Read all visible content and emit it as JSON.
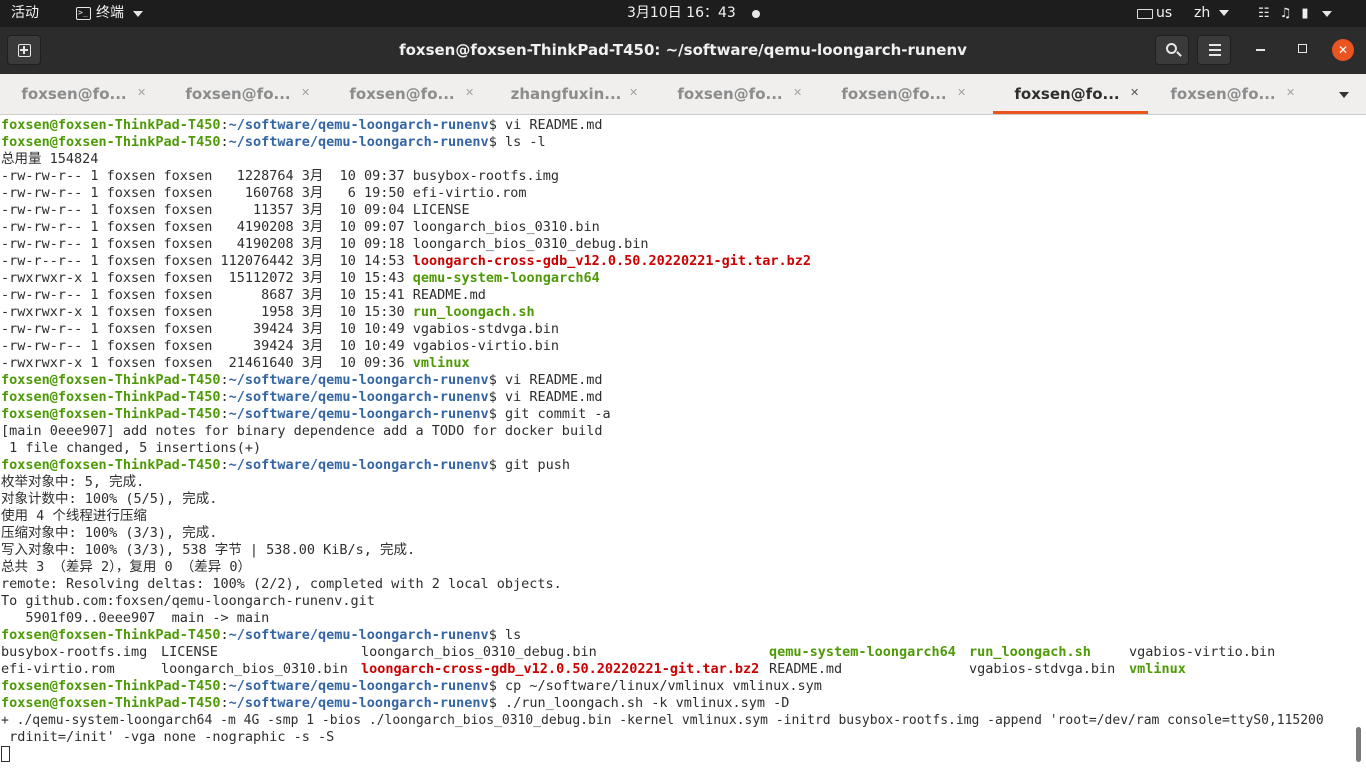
{
  "topbar": {
    "activities": "活动",
    "app_menu": "终端",
    "clock": "3月10日 16：43",
    "keyboard_layout": "us",
    "input_method": "zh"
  },
  "window": {
    "title": "foxsen@foxsen-ThinkPad-T450: ~/software/qemu-loongarch-runenv"
  },
  "tabs": [
    {
      "label": "foxsen@fo...",
      "active": false
    },
    {
      "label": "foxsen@fo...",
      "active": false
    },
    {
      "label": "foxsen@fo...",
      "active": false
    },
    {
      "label": "zhangfuxin...",
      "active": false
    },
    {
      "label": "foxsen@fo...",
      "active": false
    },
    {
      "label": "foxsen@fo...",
      "active": false
    },
    {
      "label": "foxsen@fo...",
      "active": true
    },
    {
      "label": "foxsen@fo...",
      "active": false
    }
  ],
  "terminal": {
    "user_host": "foxsen@foxsen-ThinkPad-T450",
    "path": "~/software/qemu-loongarch-runenv",
    "cmd_vi": " vi README.md",
    "cmd_ls_l": " ls -l",
    "total": "总用量 154824",
    "listing": [
      {
        "meta": "-rw-rw-r-- 1 foxsen foxsen   1228764 3月  10 09:37 ",
        "name": "busybox-rootfs.img",
        "kind": "plain"
      },
      {
        "meta": "-rw-rw-r-- 1 foxsen foxsen    160768 3月   6 19:50 ",
        "name": "efi-virtio.rom",
        "kind": "plain"
      },
      {
        "meta": "-rw-rw-r-- 1 foxsen foxsen     11357 3月  10 09:04 ",
        "name": "LICENSE",
        "kind": "plain"
      },
      {
        "meta": "-rw-rw-r-- 1 foxsen foxsen   4190208 3月  10 09:07 ",
        "name": "loongarch_bios_0310.bin",
        "kind": "plain"
      },
      {
        "meta": "-rw-rw-r-- 1 foxsen foxsen   4190208 3月  10 09:18 ",
        "name": "loongarch_bios_0310_debug.bin",
        "kind": "plain"
      },
      {
        "meta": "-rw-r--r-- 1 foxsen foxsen 112076442 3月  10 14:53 ",
        "name": "loongarch-cross-gdb_v12.0.50.20220221-git.tar.bz2",
        "kind": "archive"
      },
      {
        "meta": "-rwxrwxr-x 1 foxsen foxsen  15112072 3月  10 15:43 ",
        "name": "qemu-system-loongarch64",
        "kind": "exec"
      },
      {
        "meta": "-rw-rw-r-- 1 foxsen foxsen      8687 3月  10 15:41 ",
        "name": "README.md",
        "kind": "plain"
      },
      {
        "meta": "-rwxrwxr-x 1 foxsen foxsen      1958 3月  10 15:30 ",
        "name": "run_loongach.sh",
        "kind": "exec"
      },
      {
        "meta": "-rw-rw-r-- 1 foxsen foxsen     39424 3月  10 10:49 ",
        "name": "vgabios-stdvga.bin",
        "kind": "plain"
      },
      {
        "meta": "-rw-rw-r-- 1 foxsen foxsen     39424 3月  10 10:49 ",
        "name": "vgabios-virtio.bin",
        "kind": "plain"
      },
      {
        "meta": "-rwxrwxr-x 1 foxsen foxsen  21461640 3月  10 09:36 ",
        "name": "vmlinux",
        "kind": "exec"
      }
    ],
    "cmd_git_commit": " git commit -a",
    "commit_result_1": "[main 0eee907] add notes for binary dependence add a TODO for docker build",
    "commit_result_2": " 1 file changed, 5 insertions(+)",
    "cmd_git_push": " git push",
    "push_output": [
      "枚举对象中: 5, 完成.",
      "对象计数中: 100% (5/5), 完成.",
      "使用 4 个线程进行压缩",
      "压缩对象中: 100% (3/3), 完成.",
      "写入对象中: 100% (3/3), 538 字节 | 538.00 KiB/s, 完成.",
      "总共 3 （差异 2），复用 0 （差异 0）",
      "remote: Resolving deltas: 100% (2/2), completed with 2 local objects.",
      "To github.com:foxsen/qemu-loongarch-runenv.git",
      "   5901f09..0eee907  main -> main"
    ],
    "cmd_ls": " ls",
    "ls_row1": [
      {
        "name": "busybox-rootfs.img",
        "kind": "plain"
      },
      {
        "name": "LICENSE",
        "kind": "plain"
      },
      {
        "name": "loongarch_bios_0310_debug.bin",
        "kind": "plain"
      },
      {
        "name": "qemu-system-loongarch64",
        "kind": "exec"
      },
      {
        "name": "run_loongach.sh",
        "kind": "exec"
      },
      {
        "name": "vgabios-virtio.bin",
        "kind": "plain"
      }
    ],
    "ls_row2": [
      {
        "name": "efi-virtio.rom",
        "kind": "plain"
      },
      {
        "name": "loongarch_bios_0310.bin",
        "kind": "plain"
      },
      {
        "name": "loongarch-cross-gdb_v12.0.50.20220221-git.tar.bz2",
        "kind": "archive"
      },
      {
        "name": "README.md",
        "kind": "plain"
      },
      {
        "name": "vgabios-stdvga.bin",
        "kind": "plain"
      },
      {
        "name": "vmlinux",
        "kind": "exec"
      }
    ],
    "cmd_cp": " cp ~/software/linux/vmlinux vmlinux.sym",
    "cmd_run": " ./run_loongach.sh -k vmlinux.sym -D",
    "run_output_1": "+ ./qemu-system-loongarch64 -m 4G -smp 1 -bios ./loongarch_bios_0310_debug.bin -kernel vmlinux.sym -initrd busybox-rootfs.img -append 'root=/dev/ram console=ttyS0,115200",
    "run_output_2": " rdinit=/init' -vga none -nographic -s -S"
  }
}
